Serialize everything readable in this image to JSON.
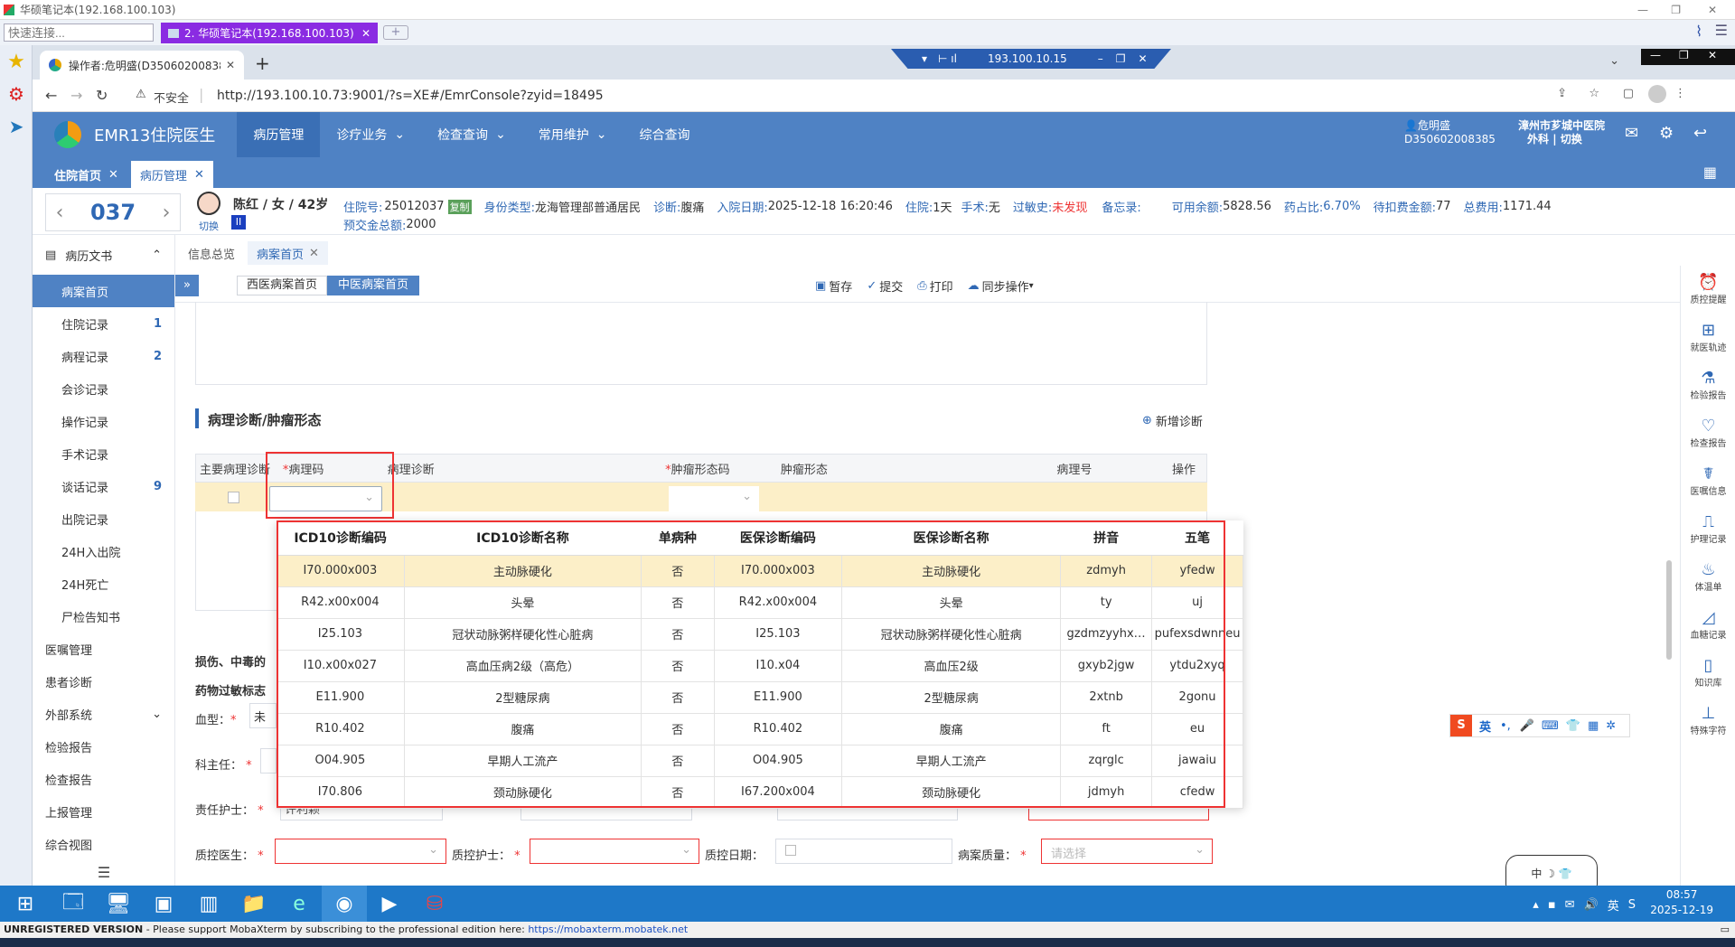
{
  "moba": {
    "window_title": "华硕笔记本(192.168.100.103)",
    "quick_connect_placeholder": "快速连接...",
    "session_tab": "2. 华硕笔记本(192.168.100.103)",
    "status_left": "UNREGISTERED VERSION",
    "status_text": "  -  Please support MobaXterm by subscribing to the professional edition here:",
    "status_link": "https://mobaxterm.mobatek.net"
  },
  "rdp": {
    "ip": "193.100.10.15"
  },
  "browser": {
    "tab_title": "操作者:危明盛(D350602008385",
    "insecure_label": "不安全",
    "url": "http://193.100.10.73:9001/?s=XE#/EmrConsole?zyid=18495"
  },
  "app": {
    "title": "EMR13住院医生",
    "nav": [
      "病历管理",
      "诊疗业务",
      "检查查询",
      "常用维护",
      "综合查询"
    ],
    "user_name": "危明盛",
    "user_id": "D350602008385",
    "hospital": "漳州市芗城中医院",
    "dept": "外科",
    "switch_label": "切换",
    "open_tabs": [
      "住院首页",
      "病历管理"
    ]
  },
  "patient": {
    "bed": "037",
    "avatar_switch": "切换",
    "level_badge": "II",
    "name_line": "陈红 / 女 / 42岁",
    "hosp_no_label": "住院号:",
    "hosp_no": "25012037",
    "reuse_badge": "复制",
    "identity_label": "身份类型:",
    "identity": "龙海管理部普通居民",
    "diag_label": "诊断:",
    "diag": "腹痛",
    "admit_label": "入院日期:",
    "admit": "2025-12-18 16:20:46",
    "stay_label": "住院:",
    "stay": "1天",
    "surgery_label": "手术:",
    "surgery": "无",
    "allergy_label": "过敏史:",
    "allergy": "未发现",
    "note_label": "备忘录:",
    "balance_label": "可用余额:",
    "balance": "5828.56",
    "drug_label": "药占比:",
    "drug": "6.70%",
    "pending_label": "待扣费金额:",
    "pending": "77",
    "total_label": "总费用:",
    "total": "1171.44",
    "prepay_label": "预交金总额:",
    "prepay": "2000"
  },
  "sidebar": {
    "section": "病历文书",
    "items": [
      {
        "label": "病案首页",
        "count": ""
      },
      {
        "label": "住院记录",
        "count": "1"
      },
      {
        "label": "病程记录",
        "count": "2"
      },
      {
        "label": "会诊记录",
        "count": ""
      },
      {
        "label": "操作记录",
        "count": ""
      },
      {
        "label": "手术记录",
        "count": ""
      },
      {
        "label": "谈话记录",
        "count": "9"
      },
      {
        "label": "出院记录",
        "count": ""
      },
      {
        "label": "24H入出院",
        "count": ""
      },
      {
        "label": "24H死亡",
        "count": ""
      },
      {
        "label": "尸检告知书",
        "count": ""
      }
    ],
    "l1": [
      "医嘱管理",
      "患者诊断",
      "外部系统",
      "检验报告",
      "检查报告",
      "上报管理",
      "综合视图"
    ]
  },
  "doc": {
    "tabs": [
      "信息总览",
      "病案首页"
    ],
    "subtabs": [
      "西医病案首页",
      "中医病案首页"
    ],
    "toolbar": [
      "暂存",
      "提交",
      "打印",
      "同步操作"
    ],
    "section_title": "病理诊断/肿瘤形态",
    "add_diag": "新增诊断",
    "grid_headers": [
      "主要病理诊断",
      "病理码",
      "病理诊断",
      "肿瘤形态码",
      "肿瘤形态",
      "病理号",
      "操作"
    ],
    "injury_label": "损伤、中毒的",
    "allergy_flag_label": "药物过敏标志",
    "blood_label": "血型：",
    "blood_val": "未",
    "dept_head_label": "科主任：",
    "nurse_label": "责任护士：",
    "nurse_val": "许利颖",
    "qc_doc_label": "质控医生：",
    "qc_nurse_label": "质控护士：",
    "qc_date_label": "质控日期：",
    "quality_label": "病案质量：",
    "quality_placeholder": "请选择"
  },
  "dropdown": {
    "headers": [
      "ICD10诊断编码",
      "ICD10诊断名称",
      "单病种",
      "医保诊断编码",
      "医保诊断名称",
      "拼音",
      "五笔"
    ],
    "rows": [
      [
        "I70.000x003",
        "主动脉硬化",
        "否",
        "I70.000x003",
        "主动脉硬化",
        "zdmyh",
        "yfedw"
      ],
      [
        "R42.x00x004",
        "头晕",
        "否",
        "R42.x00x004",
        "头晕",
        "ty",
        "uj"
      ],
      [
        "I25.103",
        "冠状动脉粥样硬化性心脏病",
        "否",
        "I25.103",
        "冠状动脉粥样硬化性心脏病",
        "gzdmzyyhx…",
        "pufexsdwnneu"
      ],
      [
        "I10.x00x027",
        "高血压病2级（高危）",
        "否",
        "I10.x04",
        "高血压2级",
        "gxyb2jgw",
        "ytdu2xyq"
      ],
      [
        "E11.900",
        "2型糖尿病",
        "否",
        "E11.900",
        "2型糖尿病",
        "2xtnb",
        "2gonu"
      ],
      [
        "R10.402",
        "腹痛",
        "否",
        "R10.402",
        "腹痛",
        "ft",
        "eu"
      ],
      [
        "O04.905",
        "早期人工流产",
        "否",
        "O04.905",
        "早期人工流产",
        "zqrglc",
        "jawaiu"
      ],
      [
        "I70.806",
        "颈动脉硬化",
        "否",
        "I67.200x004",
        "颈动脉硬化",
        "jdmyh",
        "cfedw"
      ]
    ]
  },
  "rightbar": [
    "质控提醒",
    "就医轨迹",
    "检验报告",
    "检查报告",
    "医嘱信息",
    "护理记录",
    "体温单",
    "血糖记录",
    "知识库",
    "特殊字符"
  ],
  "ime": {
    "label": "英",
    "mini": "中"
  },
  "clock": {
    "time": "08:57",
    "date": "2025-12-19"
  },
  "taskbar": {
    "tray_lang": "英"
  }
}
